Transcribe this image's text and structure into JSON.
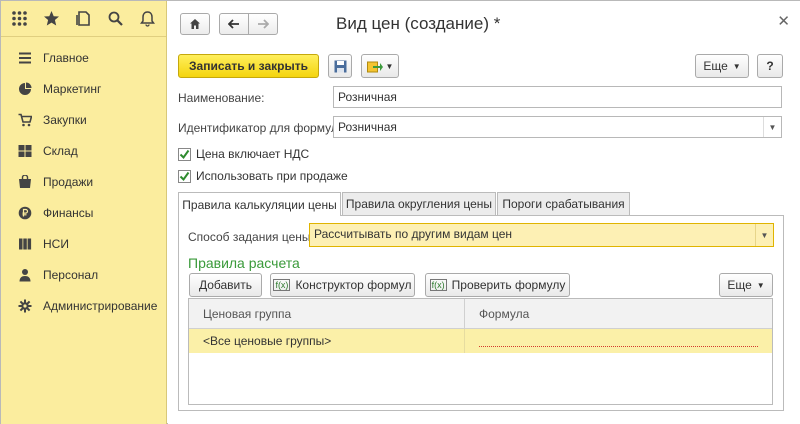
{
  "sidebar": {
    "items": [
      {
        "label": "Главное",
        "icon": "menu-lines-icon"
      },
      {
        "label": "Маркетинг",
        "icon": "pie-chart-icon"
      },
      {
        "label": "Закупки",
        "icon": "cart-icon"
      },
      {
        "label": "Склад",
        "icon": "warehouse-icon"
      },
      {
        "label": "Продажи",
        "icon": "sales-icon"
      },
      {
        "label": "Финансы",
        "icon": "ruble-icon"
      },
      {
        "label": "НСИ",
        "icon": "book-icon"
      },
      {
        "label": "Персонал",
        "icon": "person-icon"
      },
      {
        "label": "Администрирование",
        "icon": "gear-icon"
      }
    ]
  },
  "window": {
    "title": "Вид цен (создание) *"
  },
  "toolbar": {
    "save_close_label": "Записать и закрыть",
    "more_label": "Еще",
    "help_label": "?"
  },
  "form": {
    "name_label": "Наименование:",
    "name_value": "Розничная",
    "id_label": "Идентификатор для формул:",
    "id_value": "Розничная",
    "vat_label": "Цена включает НДС",
    "sale_label": "Использовать при продаже"
  },
  "tabs": [
    {
      "label": "Правила калькуляции цены"
    },
    {
      "label": "Правила округления цены"
    },
    {
      "label": "Пороги срабатывания"
    }
  ],
  "calc": {
    "method_label": "Способ задания цены:",
    "method_value": "Рассчитывать по другим видам цен",
    "section_title": "Правила расчета",
    "add_label": "Добавить",
    "constructor_label": "Конструктор формул",
    "check_label": "Проверить формулу",
    "more_label": "Еще",
    "col_group": "Ценовая группа",
    "col_formula": "Формула",
    "row_group": "<Все ценовые группы>"
  },
  "colors": {
    "sidebar_bg": "#fbed9e",
    "primary_button": "#f4d40e",
    "section_title": "#3a9a3a",
    "selected_row": "#fbf0a8"
  }
}
